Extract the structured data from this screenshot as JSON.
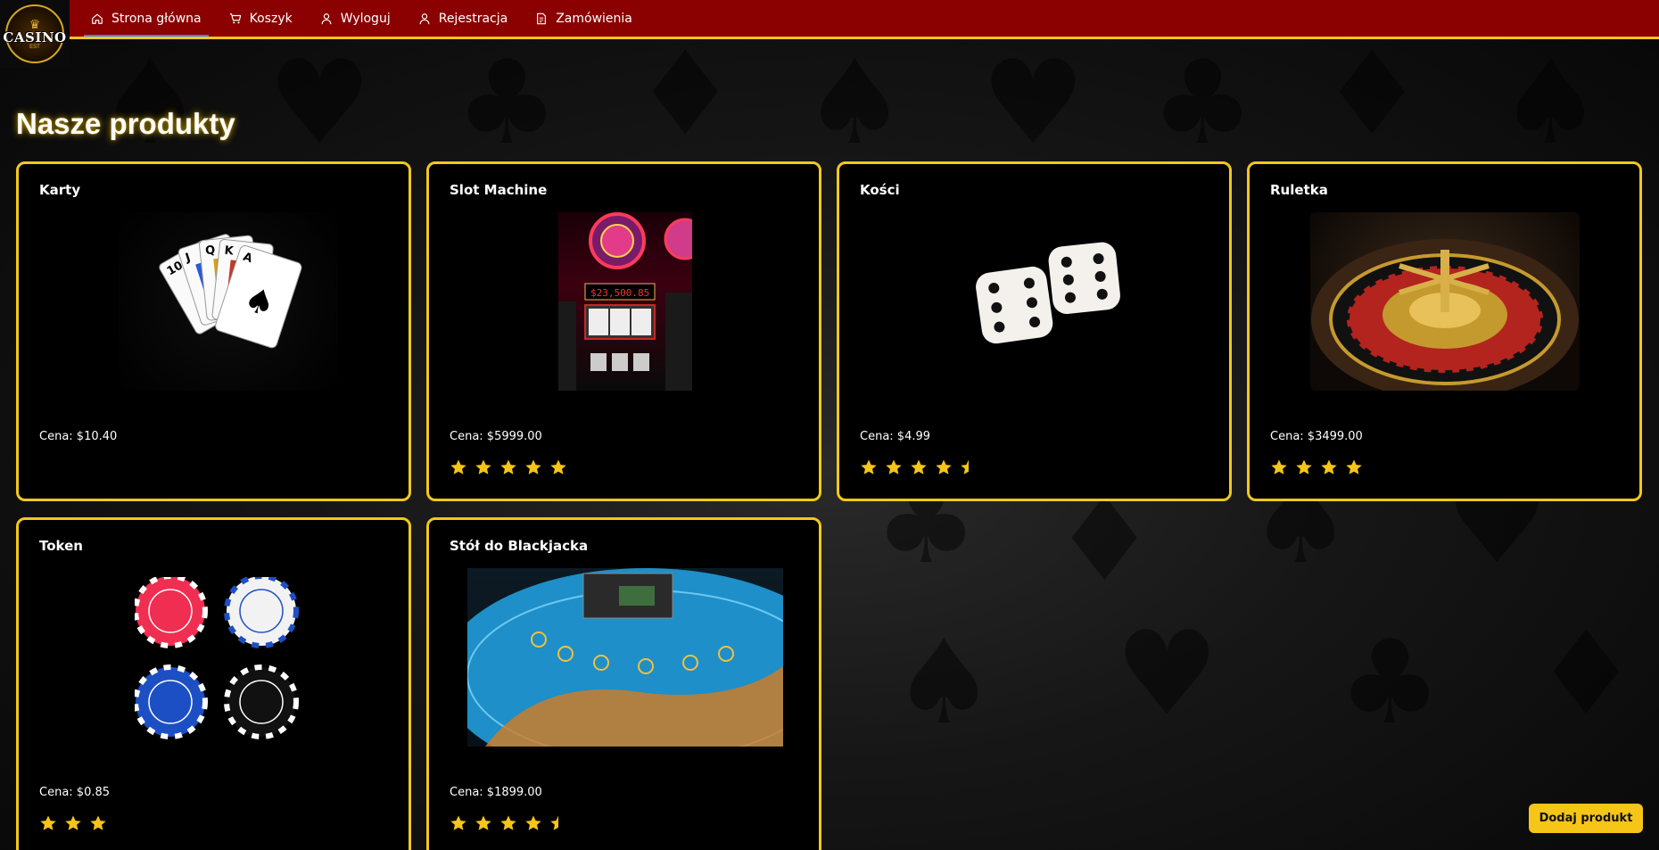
{
  "logo": {
    "text": "CASINO",
    "subtext": "EST",
    "icon": "crown-icon"
  },
  "navbar": {
    "items": [
      {
        "label": "Strona główna",
        "icon": "home-icon",
        "active": true
      },
      {
        "label": "Koszyk",
        "icon": "cart-icon",
        "active": false
      },
      {
        "label": "Wyloguj",
        "icon": "user-icon",
        "active": false
      },
      {
        "label": "Rejestracja",
        "icon": "user-icon",
        "active": false
      },
      {
        "label": "Zamówienia",
        "icon": "document-icon",
        "active": false
      }
    ]
  },
  "page": {
    "title": "Nasze produkty"
  },
  "products": [
    {
      "name": "Karty",
      "price": "Cena: $10.40",
      "rating": 0,
      "image": "playing-cards-image"
    },
    {
      "name": "Slot Machine",
      "price": "Cena: $5999.00",
      "rating": 5,
      "image": "slot-machine-image"
    },
    {
      "name": "Kości",
      "price": "Cena: $4.99",
      "rating": 4.5,
      "image": "dice-image"
    },
    {
      "name": "Ruletka",
      "price": "Cena: $3499.00",
      "rating": 4,
      "image": "roulette-image"
    },
    {
      "name": "Token",
      "price": "Cena: $0.85",
      "rating": 3,
      "image": "casino-chips-image"
    },
    {
      "name": "Stół do Blackjacka",
      "price": "Cena: $1899.00",
      "rating": 4.5,
      "image": "blackjack-table-image"
    }
  ],
  "actions": {
    "add_product_label": "Dodaj produkt"
  },
  "colors": {
    "nav_bg": "#8b0000",
    "accent_gold": "#f2c81c",
    "card_bg": "#000000",
    "star": "#f5c518"
  }
}
